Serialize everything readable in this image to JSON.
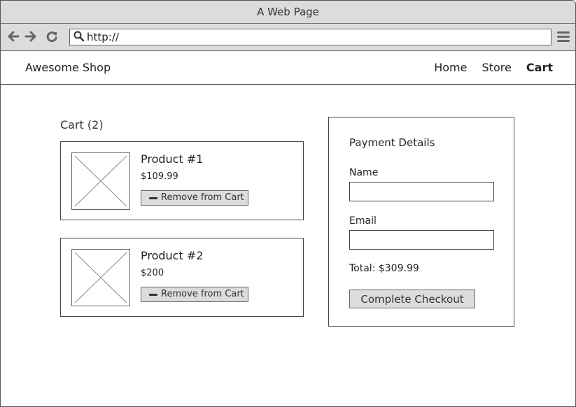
{
  "browser": {
    "title": "A Web Page",
    "url": "http://",
    "icons": {
      "back": "arrow-left-icon",
      "forward": "arrow-right-icon",
      "reload": "reload-icon",
      "search": "search-icon",
      "menu": "hamburger-menu-icon"
    }
  },
  "header": {
    "brand": "Awesome Shop",
    "nav": [
      {
        "label": "Home",
        "active": false
      },
      {
        "label": "Store",
        "active": false
      },
      {
        "label": "Cart",
        "active": true
      }
    ]
  },
  "cart": {
    "title": "Cart (2)",
    "items": [
      {
        "name": "Product #1",
        "price": "$109.99",
        "remove_label": "Remove from Cart",
        "image": "image-placeholder"
      },
      {
        "name": "Product #2",
        "price": "$200",
        "remove_label": "Remove from Cart",
        "image": "image-placeholder"
      }
    ]
  },
  "payment": {
    "title": "Payment Details",
    "fields": [
      {
        "label": "Name",
        "value": "",
        "placeholder": ""
      },
      {
        "label": "Email",
        "value": "",
        "placeholder": ""
      }
    ],
    "total": "Total: $309.99",
    "checkout_label": "Complete Checkout"
  },
  "colors": {
    "chrome_bg": "#dcdcdc",
    "button_bg": "#dcdcdc",
    "border": "#444444",
    "text": "#222222"
  }
}
